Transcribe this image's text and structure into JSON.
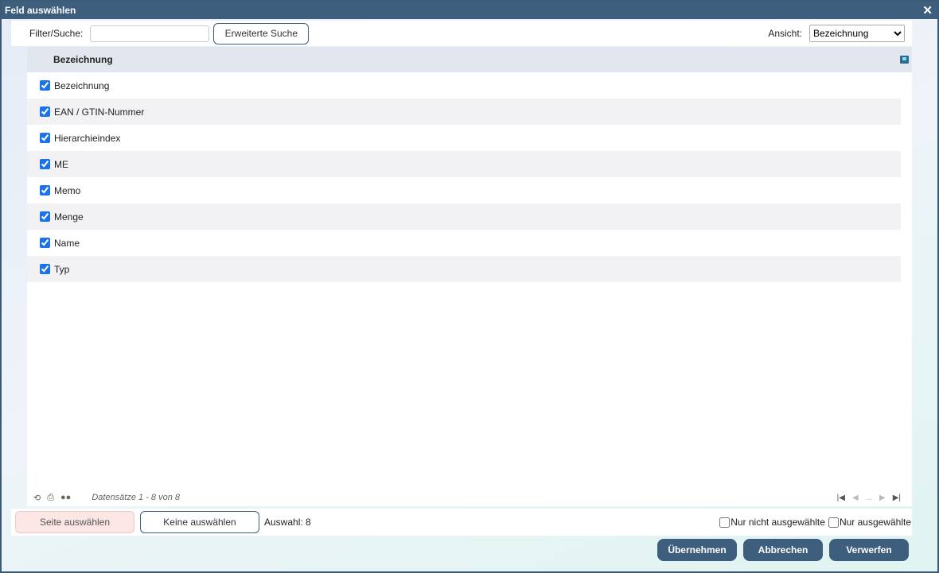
{
  "window": {
    "title": "Feld auswählen",
    "close_glyph": "✕"
  },
  "toolbar": {
    "filter_label": "Filter/Suche:",
    "search_value": "",
    "advanced_label": "Erweiterte Suche",
    "view_label": "Ansicht:",
    "view_selected": "Bezeichnung"
  },
  "grid": {
    "column_header": "Bezeichnung",
    "rows": [
      {
        "label": "Bezeichnung",
        "checked": true
      },
      {
        "label": "EAN / GTIN-Nummer",
        "checked": true
      },
      {
        "label": "Hierarchieindex",
        "checked": true
      },
      {
        "label": "ME",
        "checked": true
      },
      {
        "label": "Memo",
        "checked": true
      },
      {
        "label": "Menge",
        "checked": true
      },
      {
        "label": "Name",
        "checked": true
      },
      {
        "label": "Typ",
        "checked": true
      }
    ],
    "records_text": "Datensätze 1 - 8 von 8",
    "pager_ellipsis": "..."
  },
  "bottom": {
    "select_page_label": "Seite auswählen",
    "select_none_label": "Keine auswählen",
    "selection_text": "Auswahl: 8",
    "only_unselected_label": "Nur nicht ausgewählte",
    "only_selected_label": "Nur ausgewählte"
  },
  "actions": {
    "apply_label": "Übernehmen",
    "cancel_label": "Abbrechen",
    "discard_label": "Verwerfen"
  },
  "colors": {
    "titlebar": "#3d5e7c",
    "primary_button": "#3d5e7c",
    "header_bg": "#e2e7ef",
    "select_page_bg": "#fde6e6"
  },
  "icons": [
    "close-icon",
    "column-chooser-icon",
    "refresh-icon",
    "print-icon",
    "options-icon",
    "first-page-icon",
    "prev-page-icon",
    "next-page-icon",
    "last-page-icon"
  ]
}
